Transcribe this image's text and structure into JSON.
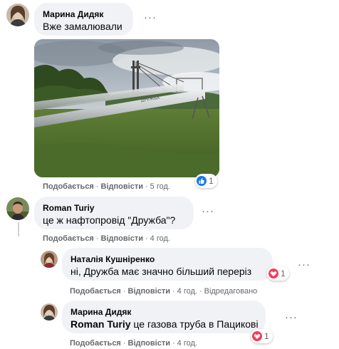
{
  "colors": {
    "bubble": "#f0f2f5",
    "secondary_text": "#65676b",
    "like_blue": "#1877f2",
    "love_red": "#f33e58"
  },
  "comments": [
    {
      "author": "Марина Дидяк",
      "text": "Вже замалювали",
      "has_photo": true,
      "photo_text": "ДРУЖБА",
      "reaction": {
        "icon": "like-icon",
        "count": "1"
      },
      "actions": {
        "like": "Подобається",
        "reply": "Відповісти",
        "time": "5 год."
      }
    },
    {
      "author": "Roman Turiy",
      "text": "це ж нафтопровід \"Дружба\"?",
      "actions": {
        "like": "Подобається",
        "reply": "Відповісти",
        "time": "4 год."
      }
    },
    {
      "author": "Наталія Кушніренко",
      "text": "ні, Дружба має значно більший переріз",
      "reaction": {
        "icon": "love-icon",
        "count": "1"
      },
      "actions": {
        "like": "Подобається",
        "reply": "Відповісти",
        "time": "4 год.",
        "edited": "Відредаговано"
      }
    },
    {
      "author": "Марина Дидяк",
      "mention": "Roman Turiy",
      "text": " це газова труба в Пацикові",
      "reaction": {
        "icon": "love-icon",
        "count": "1"
      },
      "actions": {
        "like": "Подобається",
        "reply": "Відповісти",
        "time": "4 год."
      }
    }
  ],
  "more_glyph": "···",
  "separator": "·"
}
